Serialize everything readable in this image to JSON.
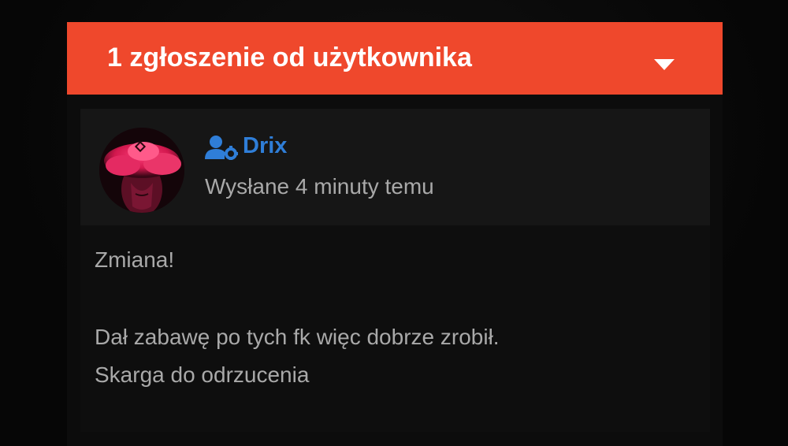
{
  "report": {
    "title": "1 zgłoszenie od użytkownika",
    "toggle_icon": "caret-down-icon",
    "header_color": "#ef482c"
  },
  "post": {
    "author": {
      "name": "Drix",
      "name_color": "#2f7ed8",
      "role_icon": "user-gear-icon",
      "avatar_icon": "avatar-image"
    },
    "time": "Wysłane 4 minuty temu",
    "body": [
      "Zmiana!",
      "Dał zabawę po tych fk więc dobrze zrobił.",
      "Skarga do odrzucenia"
    ]
  }
}
